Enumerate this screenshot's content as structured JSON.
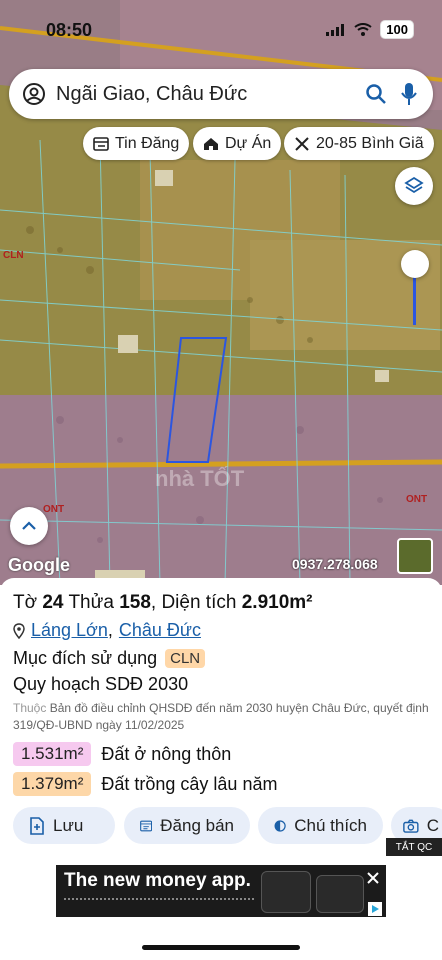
{
  "status": {
    "time": "08:50",
    "battery": "100"
  },
  "search": {
    "text": "Ngãi Giao, Châu Đức"
  },
  "chips": [
    {
      "label": "Tin Đăng",
      "icon": "list-icon"
    },
    {
      "label": "Dự Án",
      "icon": "house-icon"
    },
    {
      "label": "20-85 Bình Giã",
      "icon": "tools-icon"
    }
  ],
  "map": {
    "labels": {
      "cln": "CLN",
      "ont_left": "ONT",
      "ont_right": "ONT"
    },
    "google": "Google",
    "phone": "0937.278.068",
    "watermark": "nhà TỐT"
  },
  "parcel": {
    "sheet_label": "Tờ",
    "sheet": "24",
    "plot_label": "Thửa",
    "plot": "158",
    "area_label": "Diện tích",
    "area": "2.910m²",
    "location_place": "Láng Lớn",
    "location_sep": ",",
    "location_district": "Châu Đức",
    "purpose_label": "Mục đích sử dụng",
    "purpose_code": "CLN",
    "plan_label": "Quy hoạch SDĐ 2030",
    "source_prefix": "Thuộc",
    "source_text": "Bản đồ điều chỉnh QHSDĐ đến năm 2030 huyện Châu Đức, quyết định 319/QĐ-UBND ngày 11/02/2025",
    "areas": [
      {
        "value": "1.531m²",
        "label": "Đất ở nông thôn",
        "color": "#f6c9ef"
      },
      {
        "value": "1.379m²",
        "label": "Đất trồng cây lâu năm",
        "color": "#fdd7a8"
      }
    ]
  },
  "actions": [
    {
      "label": "Lưu"
    },
    {
      "label": "Đăng bán"
    },
    {
      "label": "Chú thích"
    },
    {
      "label": "C"
    }
  ],
  "ad": {
    "badge": "TẮT QC",
    "headline": "The new money app."
  },
  "colors": {
    "accent": "#1a5fa8",
    "action_bg": "#e8eef9",
    "ont_overlay": "#c87ad0",
    "cln_overlay": "#e8a040"
  }
}
